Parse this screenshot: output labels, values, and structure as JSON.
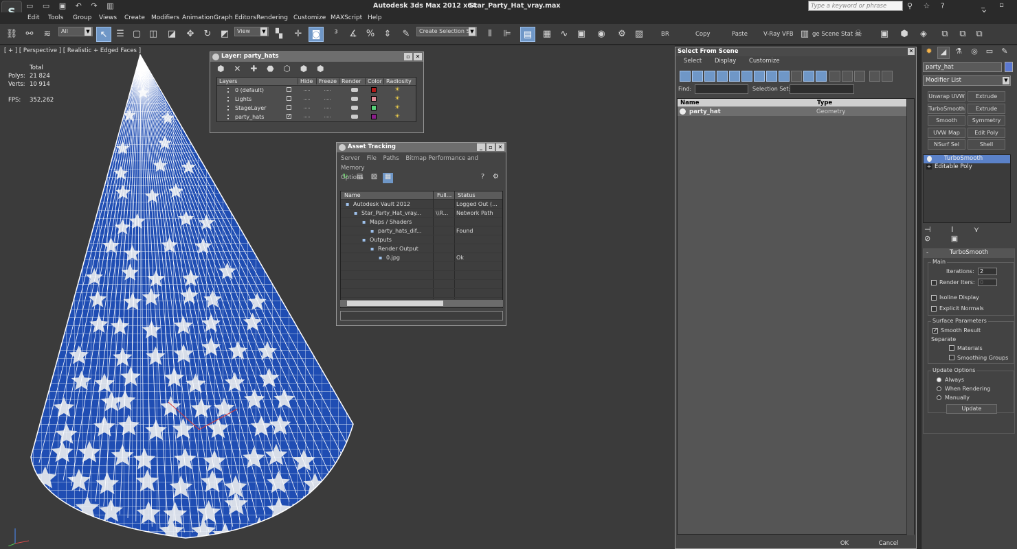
{
  "app": {
    "title": "Autodesk 3ds Max  2012 x64",
    "file": "Star_Party_Hat_vray.max",
    "search_placeholder": "Type a keyword or phrase"
  },
  "menu": [
    "Edit",
    "Tools",
    "Group",
    "Views",
    "Create",
    "Modifiers",
    "Animation",
    "Graph Editors",
    "Rendering",
    "Customize",
    "MAXScript",
    "Help"
  ],
  "toolbar": {
    "filter": "All",
    "ref_coord": "View",
    "selection_set": "Create Selection Se",
    "text_buttons": [
      "BR",
      "Copy",
      "Paste",
      "V-Ray VFB",
      "ge Scene Stat"
    ]
  },
  "viewport": {
    "label": "[ + ] [ Perspective ] [ Realistic + Edged Faces ]",
    "stats": {
      "total_label": "Total",
      "polys_label": "Polys:",
      "polys": "21 824",
      "verts_label": "Verts:",
      "verts": "10 914",
      "fps_label": "FPS:",
      "fps": "352,262"
    },
    "mesh_color": "#1f4db3"
  },
  "layer_dialog": {
    "title": "Layer: party_hats",
    "columns": [
      "Layers",
      "Hide",
      "Freeze",
      "Render",
      "Color",
      "Radiosity"
    ],
    "rows": [
      {
        "name": "0 (default)",
        "color": "#b01b1b",
        "current": false
      },
      {
        "name": "Lights",
        "color": "#e08a96",
        "current": false
      },
      {
        "name": "StageLayer",
        "color": "#58d07a",
        "current": false
      },
      {
        "name": "party_hats",
        "color": "#8a1e8a",
        "current": true
      }
    ]
  },
  "asset_tracking": {
    "title": "Asset Tracking",
    "menu": [
      "Server",
      "File",
      "Paths",
      "Bitmap Performance and Memory",
      "Options"
    ],
    "columns": [
      "Name",
      "Full...",
      "Status"
    ],
    "rows": [
      {
        "name": "Autodesk Vault 2012",
        "full": "",
        "status": "Logged Out (..."
      },
      {
        "name": "Star_Party_Hat_vray...",
        "full": "\\\\R...",
        "status": "Network Path"
      },
      {
        "name": "Maps / Shaders",
        "full": "",
        "status": ""
      },
      {
        "name": "party_hats_dif...",
        "full": "",
        "status": "Found"
      },
      {
        "name": "Outputs",
        "full": "",
        "status": ""
      },
      {
        "name": "Render Output",
        "full": "",
        "status": ""
      },
      {
        "name": "0.jpg",
        "full": "",
        "status": "Ok"
      }
    ]
  },
  "select_from_scene": {
    "title": "Select From Scene",
    "menu": [
      "Select",
      "Display",
      "Customize"
    ],
    "find_label": "Find:",
    "selection_set_label": "Selection Set:",
    "columns": [
      "Name",
      "Type"
    ],
    "rows": [
      {
        "name": "party_hat",
        "type": "Geometry"
      }
    ],
    "ok": "OK",
    "cancel": "Cancel"
  },
  "command_panel": {
    "object_name": "party_hat",
    "object_color": "#5b78d1",
    "modifier_list": "Modifier List",
    "modifier_buttons": [
      "Unwrap UVW",
      "Extrude",
      "TurboSmooth",
      "Extrude",
      "Smooth",
      "Symmetry",
      "UVW Map",
      "Edit Poly",
      "NSurf Sel",
      "Shell"
    ],
    "stack": [
      {
        "name": "TurboSmooth",
        "selected": true
      },
      {
        "name": "Editable Poly",
        "selected": false
      }
    ],
    "turbosmooth": {
      "title": "TurboSmooth",
      "main_label": "Main",
      "iterations_label": "Iterations:",
      "iterations": "2",
      "render_iters_label": "Render Iters:",
      "render_iters": "0",
      "isoline_label": "Isoline Display",
      "explicit_normals_label": "Explicit Normals",
      "surface_params_label": "Surface Parameters",
      "smooth_result_label": "Smooth Result",
      "separate_label": "Separate",
      "materials_label": "Materials",
      "smoothing_groups_label": "Smoothing Groups",
      "update_options_label": "Update Options",
      "always_label": "Always",
      "when_rendering_label": "When Rendering",
      "manually_label": "Manually",
      "update_button": "Update"
    }
  }
}
